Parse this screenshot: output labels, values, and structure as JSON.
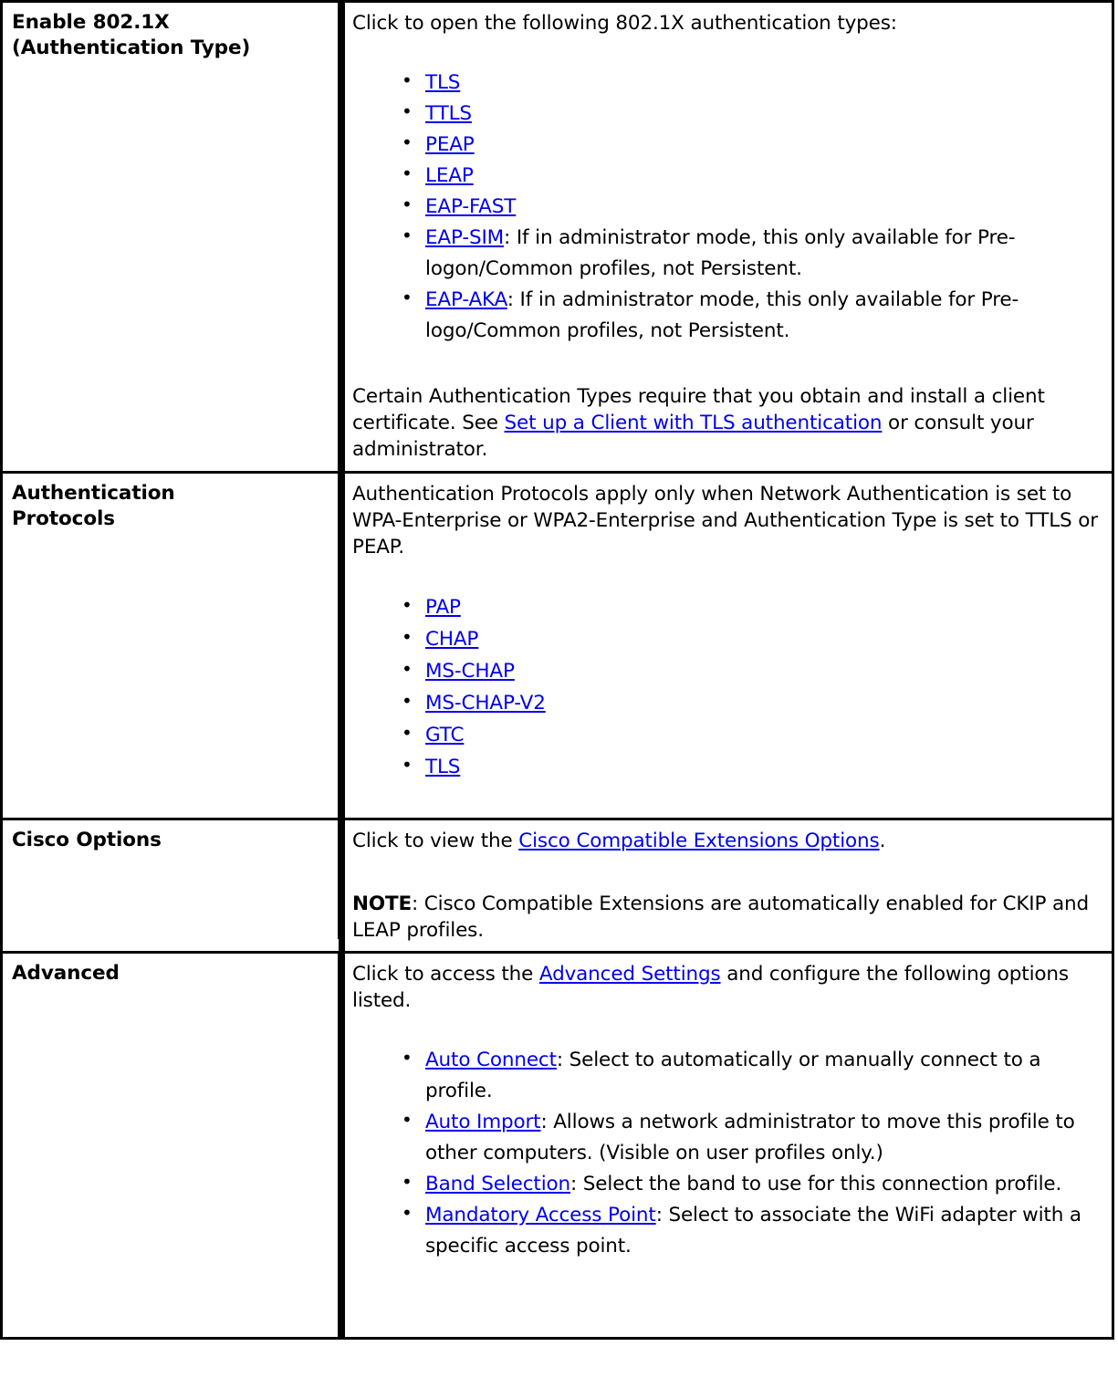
{
  "table": {
    "rows": [
      {
        "term": "Enable 802.1X\n(Authentication Type)",
        "term_line1": "Enable 802.1X",
        "term_line2": "(Authentication Type)",
        "intro": "Click to open the following 802.1X authentication types:",
        "list": [
          {
            "link": "TLS",
            "rest": ""
          },
          {
            "link": "TTLS",
            "rest": ""
          },
          {
            "link": "PEAP",
            "rest": ""
          },
          {
            "link": "LEAP",
            "rest": ""
          },
          {
            "link": "EAP-FAST",
            "rest": ""
          },
          {
            "link": "EAP-SIM",
            "rest": ": If in administrator mode, this only available for Pre-logon/Common profiles, not Persistent."
          },
          {
            "link": "EAP-AKA",
            "rest": ": If in administrator mode, this only available for Pre-logo/Common profiles, not Persistent."
          }
        ],
        "outro_pre": "Certain Authentication Types require that you obtain and install a client certificate. See ",
        "outro_link": "Set up a Client with TLS authentication",
        "outro_post": " or consult your administrator."
      },
      {
        "term_line1": "Authentication",
        "term_line2": "Protocols",
        "intro": "Authentication Protocols apply only when Network Authentication is set to WPA-Enterprise or WPA2-Enterprise and Authentication Type is set to TTLS or PEAP.",
        "list": [
          {
            "link": "PAP",
            "rest": ""
          },
          {
            "link": "CHAP",
            "rest": ""
          },
          {
            "link": "MS-CHAP",
            "rest": ""
          },
          {
            "link": "MS-CHAP-V2",
            "rest": ""
          },
          {
            "link": "GTC",
            "rest": ""
          },
          {
            "link": "TLS",
            "rest": ""
          }
        ]
      },
      {
        "term_line1": "Cisco Options",
        "term_line2": "",
        "intro_pre": "Click to view the ",
        "intro_link": "Cisco Compatible Extensions Options",
        "intro_post": ".",
        "note_label": "NOTE",
        "note_text": ": Cisco Compatible Extensions are automatically enabled for CKIP and LEAP profiles."
      },
      {
        "term_line1": "Advanced",
        "term_line2": "",
        "intro_pre": "Click to access the ",
        "intro_link": "Advanced Settings",
        "intro_post": " and configure the following options listed.",
        "list": [
          {
            "link": "Auto Connect",
            "rest": ": Select to automatically or manually connect to a profile."
          },
          {
            "link": "Auto Import",
            "rest": ": Allows a network administrator to move this profile to other computers. (Visible on user profiles only.)"
          },
          {
            "link": "Band Selection",
            "rest": ": Select the band to use for this connection profile."
          },
          {
            "link": "Mandatory Access Point",
            "rest": ": Select to associate the WiFi adapter with a specific access point."
          }
        ]
      }
    ]
  },
  "colors": {
    "link": "#0000EE",
    "text": "#000000",
    "border": "#000000",
    "background": "#FFFFFF"
  }
}
